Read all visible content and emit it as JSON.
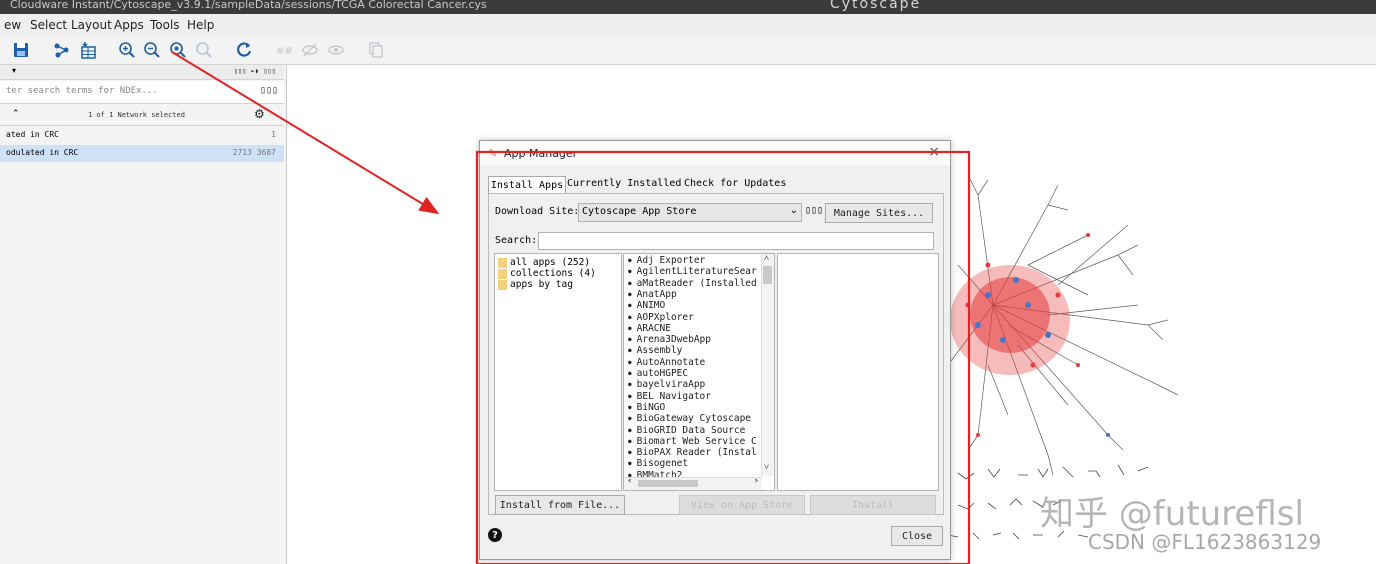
{
  "window": {
    "title": "Cloudware Instant/Cytoscape_v3.9.1/sampleData/sessions/TCGA Colorectal Cancer.cys",
    "title_extra": "Cytoscape"
  },
  "menu": [
    "ew",
    "Select",
    "Layout",
    "Apps",
    "Tools",
    "Help"
  ],
  "toolbar": {
    "icons": [
      "save-icon",
      "import-network-icon",
      "import-table-icon",
      "zoom-in-icon",
      "zoom-out-icon",
      "zoom-fit-icon",
      "zoom-selected-icon",
      "refresh-icon",
      "hide-icon",
      "show-icon",
      "eye-icon",
      "copy-icon"
    ]
  },
  "left_panel": {
    "dropdown_label": "▾",
    "header_right": "▯▯▯ ▸◗ ▯▯▯",
    "search_placeholder": "ter search terms for NDEx...",
    "search_button": "▯▯▯",
    "status": "1 of 1 Network selected",
    "networks": [
      {
        "name": "ated in CRC",
        "count": "1"
      },
      {
        "name": "odulated in CRC",
        "count": "2713  3687"
      }
    ]
  },
  "dialog": {
    "title": "App Manager",
    "close_glyph": "×",
    "tabs": [
      "Install Apps",
      "Currently Installed",
      "Check for Updates"
    ],
    "download_site_label": "Download Site:",
    "download_site_value": "Cytoscape App Store",
    "site_button": "▯▯▯",
    "manage_sites": "Manage Sites...",
    "search_label": "Search:",
    "search_value": "",
    "categories": [
      "all apps (252)",
      "collections (4)",
      "apps by tag"
    ],
    "apps": [
      "Adj Exporter",
      "AgilentLiteratureSear",
      "aMatReader (Installed",
      "AnatApp",
      "ANIMO",
      "AOPXplorer",
      "ARACNE",
      "Arena3DwebApp",
      "Assembly",
      "AutoAnnotate",
      "autoHGPEC",
      "bayelviraApp",
      "BEL Navigator",
      "BiNGO",
      "BioGateway Cytoscape",
      "BioGRID Data Source",
      "Biomart Web Service C",
      "BioPAX Reader (Instal",
      "Bisogenet",
      "BMMatch2"
    ],
    "install_from_file": "Install from File...",
    "install_button": "Install",
    "view_store_button": "View on App Store",
    "close_button": "Close",
    "help_glyph": "?"
  },
  "watermark": {
    "line1": "知乎 @futureflsl",
    "line2": "CSDN @FL1623863129"
  },
  "colors": {
    "annotation_red": "#e02424",
    "selected_row": "#cfe1f7",
    "node_red": "#e63b3b",
    "node_blue": "#4a74c9"
  }
}
